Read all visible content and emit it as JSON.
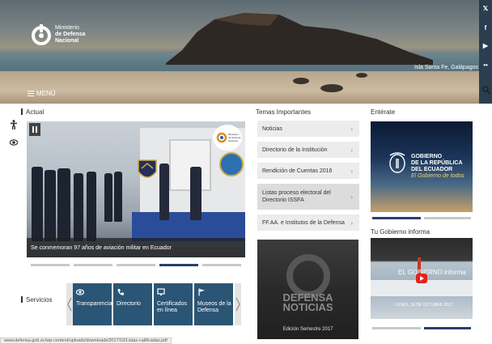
{
  "header": {
    "logo_line1": "Ministerio",
    "logo_line2": "de Defensa",
    "logo_line3": "Nacional",
    "photo_caption": "Isla Santa Fe, Galápagos",
    "menu_label": "MENÚ"
  },
  "social": {
    "twitter_icon": "twitter-icon",
    "facebook_icon": "facebook-icon",
    "youtube_icon": "youtube-icon",
    "flickr_icon": "flickr-icon",
    "search_icon": "search-icon"
  },
  "sections": {
    "actual": "Actual",
    "temas": "Temas Importantes",
    "enterate": "Entérate",
    "tu_gobierno": "Tu Gobierno informa",
    "servicios": "Servicios"
  },
  "carousel": {
    "caption": "Se conmemoran 97 años de aviación militar en Ecuador",
    "seal_text": "Ministerio de Defensa Nacional",
    "active_slide": 4,
    "slide_count": 5
  },
  "temas": [
    {
      "label": "Noticias"
    },
    {
      "label": "Directorio de la Institución"
    },
    {
      "label": "Rendición de Cuentas 2016"
    },
    {
      "label": "Listas proceso electoral del Directorio ISSFA"
    },
    {
      "label": "FF.AA. e Institutos de la Defensa"
    }
  ],
  "defensa_noticias": {
    "title_line1": "DEFENSA",
    "title_line2": "NOTICIAS",
    "edition": "Edición Semestre 2017"
  },
  "enterate": {
    "line1": "GOBIERNO",
    "line2": "DE LA REPÚBLICA",
    "line3": "DEL ECUADOR",
    "tagline": "El Gobierno de todos"
  },
  "tu_gobierno": {
    "title": "EL GOBIERNO informa",
    "date": "LUNES, 16 DE OCTUBRE 2017"
  },
  "servicios": [
    {
      "label": "Transparencia",
      "icon": "eye-icon"
    },
    {
      "label": "Directorio",
      "icon": "phone-icon"
    },
    {
      "label": "Certificados en línea",
      "icon": "monitor-icon"
    },
    {
      "label": "Museos de la Defensa",
      "icon": "flag-icon"
    }
  ],
  "status_url": "www.defensa.gob.ec/wp-content/uploads/downloads/2017/10/Listas-calificadas.pdf",
  "colors": {
    "accent": "#2b3e6b",
    "service_tile": "#2b5575",
    "social_strip": "#2b3e4f"
  }
}
